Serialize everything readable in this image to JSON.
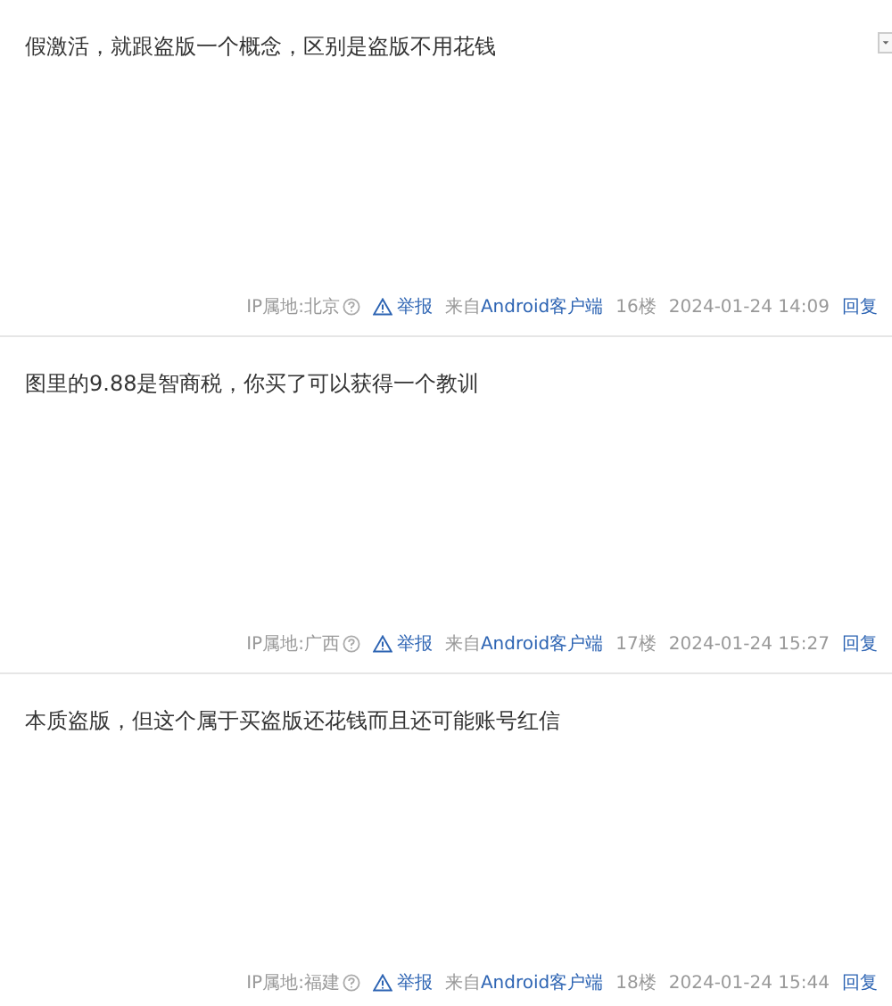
{
  "posts": [
    {
      "text": "假激活，就跟盗版一个概念，区别是盗版不用花钱",
      "ip": "IP属地:北京",
      "report": "举报",
      "source_prefix": "来自",
      "source_link": "Android客户端",
      "floor": "16楼",
      "time": "2024-01-24 14:09",
      "reply": "回复"
    },
    {
      "text": "图里的9.88是智商税，你买了可以获得一个教训",
      "ip": "IP属地:广西",
      "report": "举报",
      "source_prefix": "来自",
      "source_link": "Android客户端",
      "floor": "17楼",
      "time": "2024-01-24 15:27",
      "reply": "回复"
    },
    {
      "text": "本质盗版，但这个属于买盗版还花钱而且还可能账号红信",
      "ip": "IP属地:福建",
      "report": "举报",
      "source_prefix": "来自",
      "source_link": "Android客户端",
      "floor": "18楼",
      "time": "2024-01-24 15:44",
      "reply": "回复"
    }
  ]
}
